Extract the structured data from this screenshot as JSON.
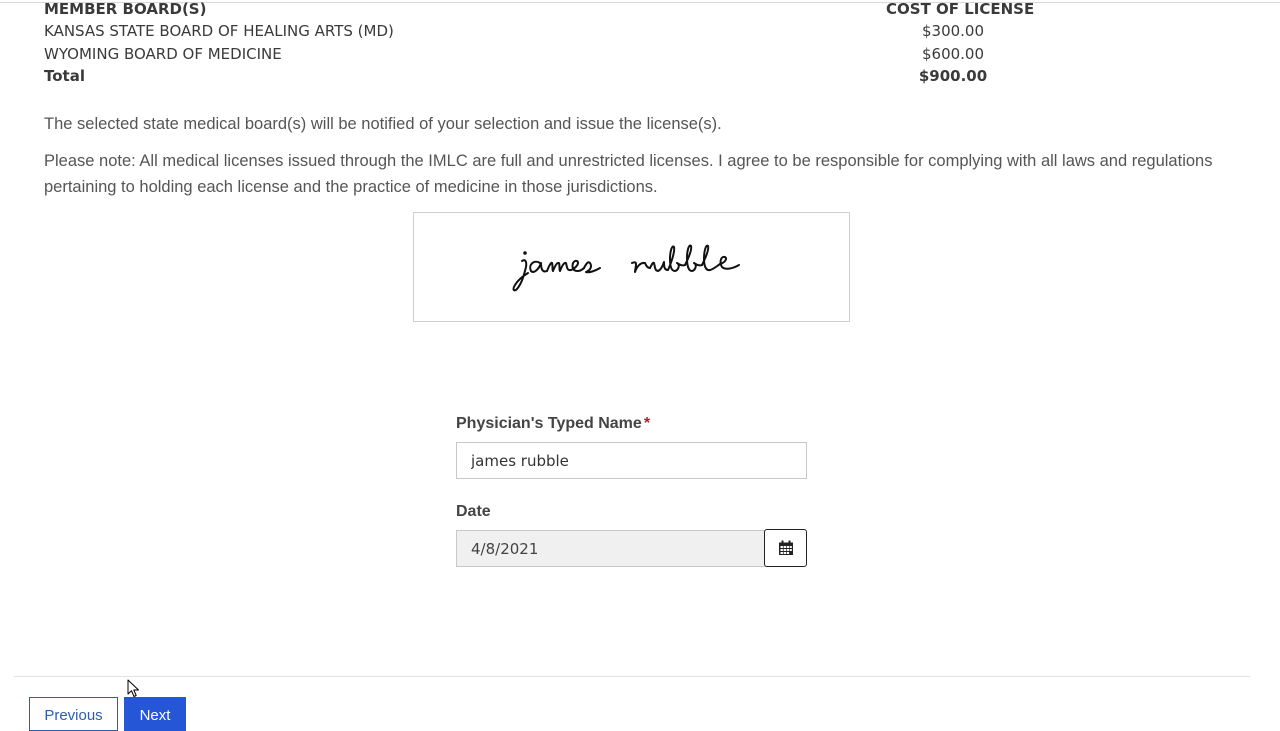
{
  "license_costs": {
    "header": {
      "board": "MEMBER BOARD(S)",
      "cost": "COST OF LICENSE"
    },
    "rows": [
      {
        "board": "KANSAS STATE BOARD OF HEALING ARTS (MD)",
        "cost": "$300.00"
      },
      {
        "board": "WYOMING BOARD OF MEDICINE",
        "cost": "$600.00"
      }
    ],
    "total": {
      "label": "Total",
      "cost": "$900.00"
    }
  },
  "notices": {
    "notification": "The selected state medical board(s) will be notified of your selection and issue the license(s).",
    "agreement": "Please note: All medical licenses issued through the IMLC are full and unrestricted licenses. I agree to be responsible for complying with all laws and regulations pertaining to holding each license and the practice of medicine in those jurisdictions."
  },
  "signature": {
    "text": "james rubble"
  },
  "form": {
    "typed_name": {
      "label": "Physician's Typed Name",
      "required_marker": "*",
      "value": "james rubble"
    },
    "date": {
      "label": "Date",
      "value": "4/8/2021",
      "button_icon": "calendar-icon"
    }
  },
  "navigation": {
    "previous_label": "Previous",
    "next_label": "Next"
  },
  "colors": {
    "next_button": "#2456d6",
    "previous_border": "#2d5fa8",
    "required": "#a4262c"
  }
}
